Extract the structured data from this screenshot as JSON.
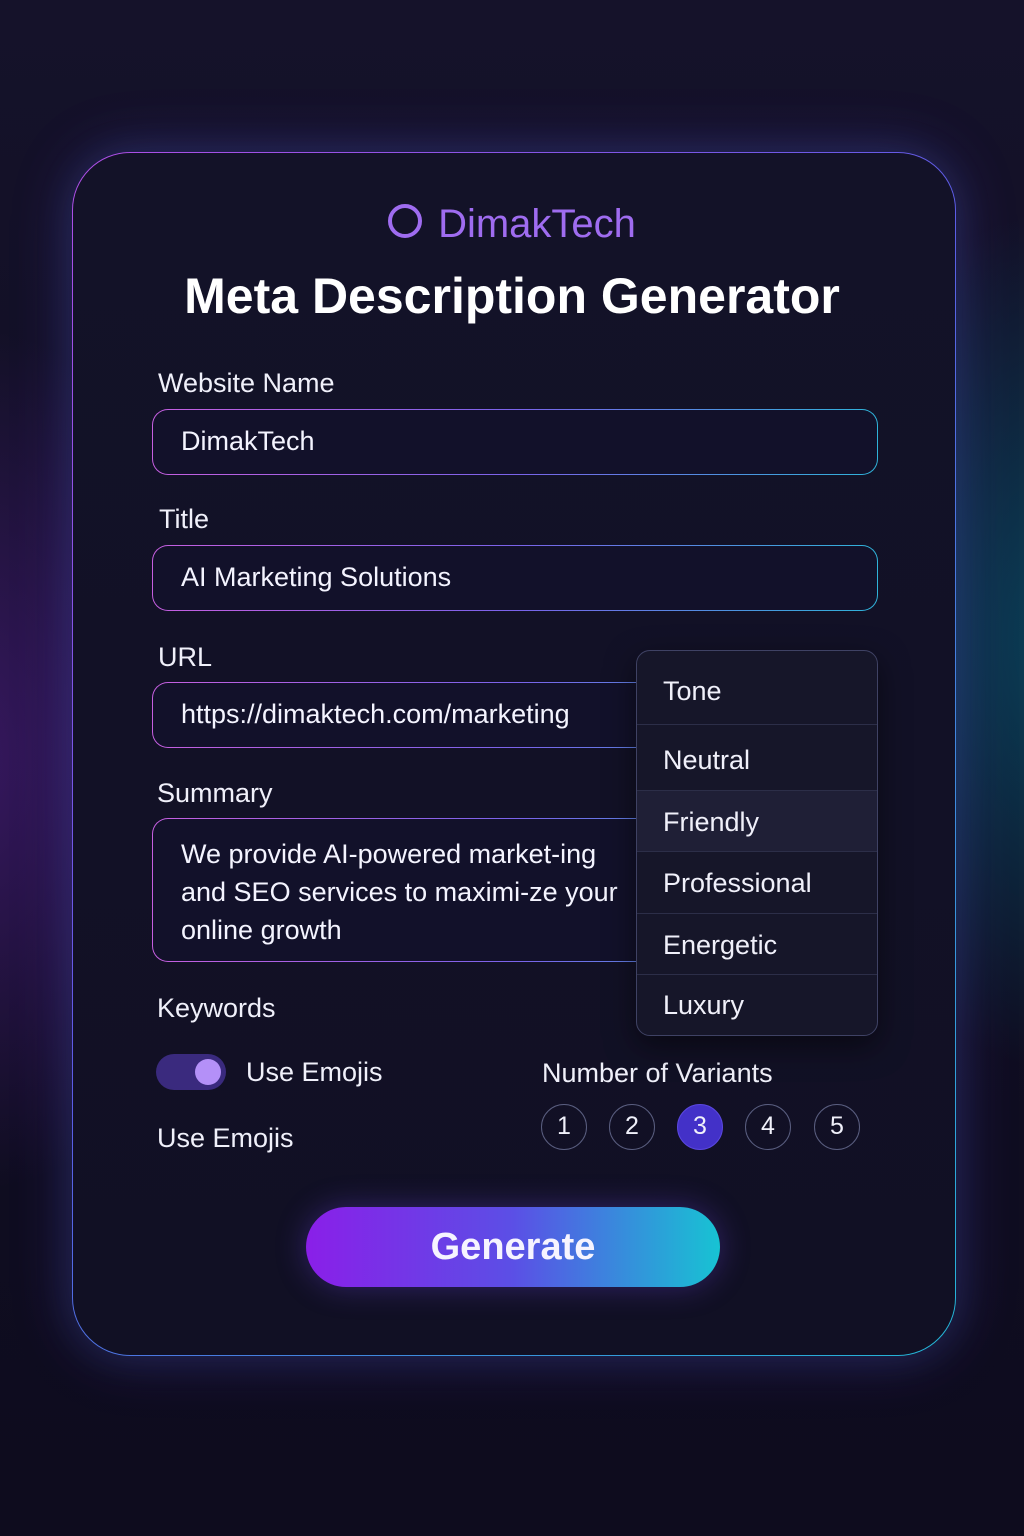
{
  "brand": {
    "name": "DimakTech",
    "icon": "ring-icon",
    "color": "#9f6cf0"
  },
  "page_title": "Meta Description Generator",
  "form": {
    "website_name": {
      "label": "Website Name",
      "value": "DimakTech"
    },
    "title": {
      "label": "Title",
      "value": "AI Marketing Solutions"
    },
    "url": {
      "label": "URL",
      "value": "https://dimaktech.com/marketing"
    },
    "summary": {
      "label": "Summary",
      "value": "We provide AI-powered market-ing and SEO services to maximi-ze your online growth"
    },
    "keywords": {
      "label": "Keywords"
    },
    "emoji_toggle": {
      "label": "Use Emojis",
      "on": true
    },
    "emoji_label": "Use Emojis"
  },
  "tone_dropdown": {
    "header": "Tone",
    "options": [
      "Neutral",
      "Friendly",
      "Professional",
      "Energetic",
      "Luxury"
    ],
    "highlighted": "Friendly"
  },
  "variants": {
    "label": "Number of Variants",
    "options": [
      "1",
      "2",
      "3",
      "4",
      "5"
    ],
    "selected": "3"
  },
  "generate_button": {
    "label": "Generate"
  },
  "colors": {
    "accent_purple": "#8a1fe8",
    "accent_cyan": "#17c3d3",
    "selected_variant": "#4331c8",
    "background": "#0f0d20"
  }
}
